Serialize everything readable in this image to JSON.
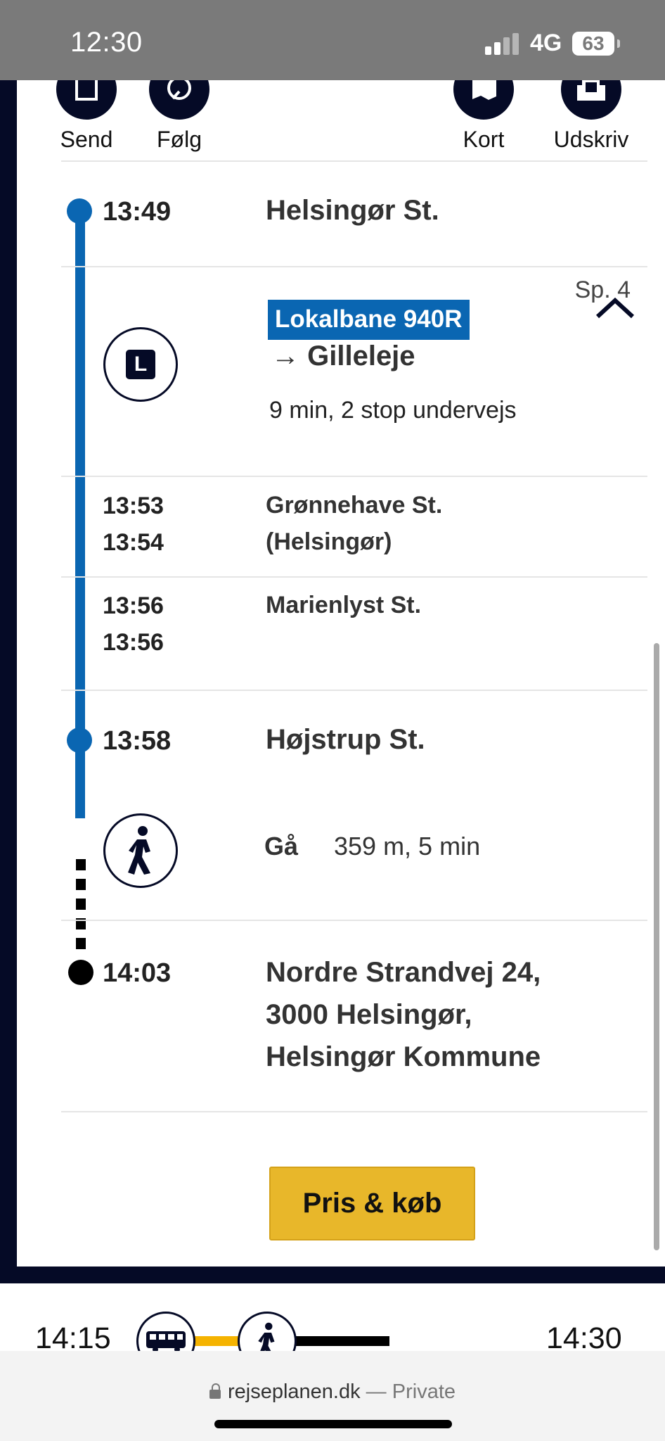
{
  "status": {
    "time": "12:30",
    "network": "4G",
    "battery": "63"
  },
  "toolbar": {
    "send": "Send",
    "follow": "Følg",
    "map": "Kort",
    "print": "Udskriv"
  },
  "itinerary": {
    "start": {
      "time": "13:49",
      "place": "Helsingør St.",
      "platform": "Sp. 4"
    },
    "train": {
      "route": "Lokalbane 940R",
      "direction_arrow": "→",
      "direction": "Gilleleje",
      "duration": "9 min, 2 stop undervejs",
      "mode": "L"
    },
    "stops": [
      {
        "arrival": "13:53",
        "departure": "13:54",
        "name_line1": "Grønnehave St.",
        "name_line2": "(Helsingør)"
      },
      {
        "arrival": "13:56",
        "departure": "13:56",
        "name_line1": "Marienlyst St.",
        "name_line2": ""
      }
    ],
    "transfer": {
      "time": "13:58",
      "place": "Højstrup St."
    },
    "walk": {
      "label": "Gå",
      "info": "359 m, 5 min"
    },
    "destination": {
      "time": "14:03",
      "line1": "Nordre Strandvej 24,",
      "line2": "3000 Helsingør,",
      "line3": "Helsingør Kommune"
    }
  },
  "actions": {
    "buy": "Pris & køb"
  },
  "next_trip": {
    "departure": "14:15",
    "arrival": "14:30"
  },
  "browser": {
    "domain": "rejseplanen.dk",
    "separator": " — ",
    "privacy": "Private"
  },
  "icons": {
    "send": "send-icon",
    "follow": "follow-icon",
    "map": "map-icon",
    "print": "print-icon",
    "collapse": "chevron-up-icon",
    "walk": "walking-person-icon",
    "bus": "bus-icon",
    "lock": "lock-icon"
  },
  "colors": {
    "accent": "#0a66b2",
    "navy": "#050a26",
    "button": "#e8b72a",
    "walk_line": "#000000",
    "bus_line": "#f5b300"
  }
}
